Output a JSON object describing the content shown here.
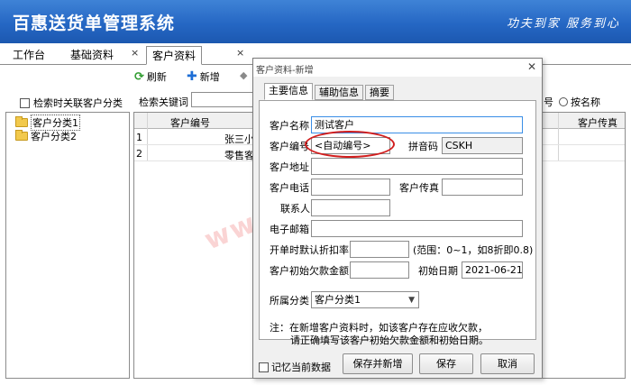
{
  "app": {
    "title": "百惠送货单管理系统",
    "slogan": "功夫到家 服务到心"
  },
  "tabs": [
    {
      "label": "工作台",
      "closable": false
    },
    {
      "label": "基础资料",
      "closable": true
    },
    {
      "label": "客户资料",
      "closable": true,
      "active": true
    }
  ],
  "toolbar": {
    "refresh_label": "刷新",
    "add_label": "新增"
  },
  "left": {
    "search_by_category_label": "检索时关联客户分类",
    "tree": [
      {
        "label": "客户分类1",
        "selected": true
      },
      {
        "label": "客户分类2",
        "selected": false
      }
    ]
  },
  "search": {
    "label": "检索关键词",
    "value": "",
    "right_fragment": "号",
    "radio_label": "按名称"
  },
  "grid": {
    "headers": [
      "客户编号",
      "客户传真"
    ],
    "rows": [
      {
        "num": "1",
        "name": "张三小"
      },
      {
        "num": "2",
        "name": "零售客"
      }
    ]
  },
  "dialog": {
    "title": "客户资料-新增",
    "tabs": [
      "主要信息",
      "辅助信息",
      "摘要"
    ],
    "fields": {
      "name_label": "客户名称",
      "name_value": "测试客户",
      "code_label": "客户编号",
      "code_value": "<自动编号>",
      "pinyin_label": "拼音码",
      "pinyin_value": "CSKH",
      "address_label": "客户地址",
      "phone_label": "客户电话",
      "fax_label": "客户传真",
      "contact_label": "联系人",
      "email_label": "电子邮箱",
      "discount_label": "开单时默认折扣率",
      "discount_hint": "(范围：0~1，如8折即0.8)",
      "debt_label": "客户初始欠款金额",
      "init_date_label": "初始日期",
      "init_date_value": "2021-06-21",
      "category_label": "所属分类",
      "category_value": "客户分类1"
    },
    "note_line1": "注：在新增客户资料时，如该客户存在应收欠款，",
    "note_line2": "请正确填写该客户初始欠款金额和初始日期。",
    "remember_label": "记忆当前数据",
    "buttons": {
      "save_new": "保存并新增",
      "save": "保存",
      "cancel": "取消"
    }
  },
  "watermark": "www.baoded.com",
  "colors": {
    "titlebar": "#2567c4",
    "highlight_ellipse": "#d11e1e",
    "active_input_border": "#3a8ee6"
  }
}
